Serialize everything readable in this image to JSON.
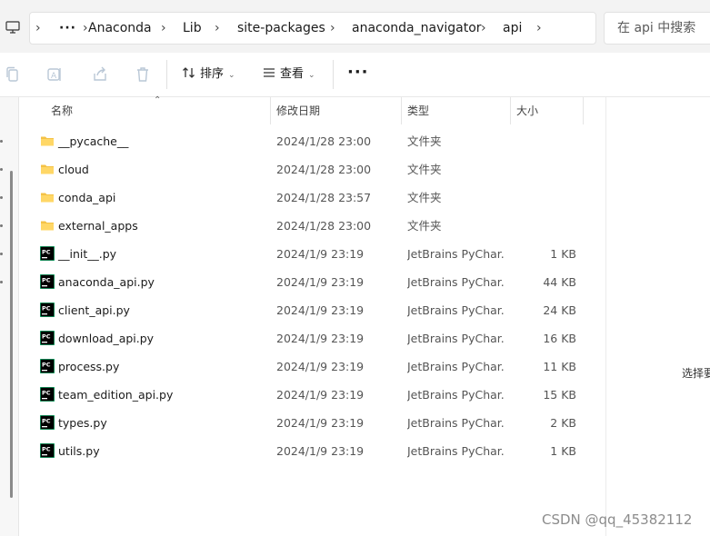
{
  "address_bar": {
    "computer_icon": "computer-icon",
    "overflow": "···",
    "breadcrumbs": [
      "Anaconda",
      "Lib",
      "site-packages",
      "anaconda_navigator",
      "api"
    ],
    "search_placeholder": "在 api 中搜索"
  },
  "toolbar": {
    "sort_label": "排序",
    "view_label": "查看",
    "more_label": "···"
  },
  "columns": {
    "name": "名称",
    "modified": "修改日期",
    "type": "类型",
    "size": "大小"
  },
  "files": [
    {
      "name": "__pycache__",
      "modified": "2024/1/28 23:00",
      "type": "文件夹",
      "size": "",
      "kind": "folder"
    },
    {
      "name": "cloud",
      "modified": "2024/1/28 23:00",
      "type": "文件夹",
      "size": "",
      "kind": "folder"
    },
    {
      "name": "conda_api",
      "modified": "2024/1/28 23:57",
      "type": "文件夹",
      "size": "",
      "kind": "folder"
    },
    {
      "name": "external_apps",
      "modified": "2024/1/28 23:00",
      "type": "文件夹",
      "size": "",
      "kind": "folder"
    },
    {
      "name": "__init__.py",
      "modified": "2024/1/9 23:19",
      "type": "JetBrains PyChar...",
      "size": "1 KB",
      "kind": "pycharm"
    },
    {
      "name": "anaconda_api.py",
      "modified": "2024/1/9 23:19",
      "type": "JetBrains PyChar...",
      "size": "44 KB",
      "kind": "pycharm"
    },
    {
      "name": "client_api.py",
      "modified": "2024/1/9 23:19",
      "type": "JetBrains PyChar...",
      "size": "24 KB",
      "kind": "pycharm"
    },
    {
      "name": "download_api.py",
      "modified": "2024/1/9 23:19",
      "type": "JetBrains PyChar...",
      "size": "16 KB",
      "kind": "pycharm"
    },
    {
      "name": "process.py",
      "modified": "2024/1/9 23:19",
      "type": "JetBrains PyChar...",
      "size": "11 KB",
      "kind": "pycharm"
    },
    {
      "name": "team_edition_api.py",
      "modified": "2024/1/9 23:19",
      "type": "JetBrains PyChar...",
      "size": "15 KB",
      "kind": "pycharm"
    },
    {
      "name": "types.py",
      "modified": "2024/1/9 23:19",
      "type": "JetBrains PyChar...",
      "size": "2 KB",
      "kind": "pycharm"
    },
    {
      "name": "utils.py",
      "modified": "2024/1/9 23:19",
      "type": "JetBrains PyChar...",
      "size": "1 KB",
      "kind": "pycharm"
    }
  ],
  "details_pane_text": "选择要",
  "watermark": "CSDN @qq_45382112",
  "colors": {
    "folder": "#f4c246",
    "pycharm_bg": "#000000",
    "pycharm_accent": "#21d789"
  }
}
